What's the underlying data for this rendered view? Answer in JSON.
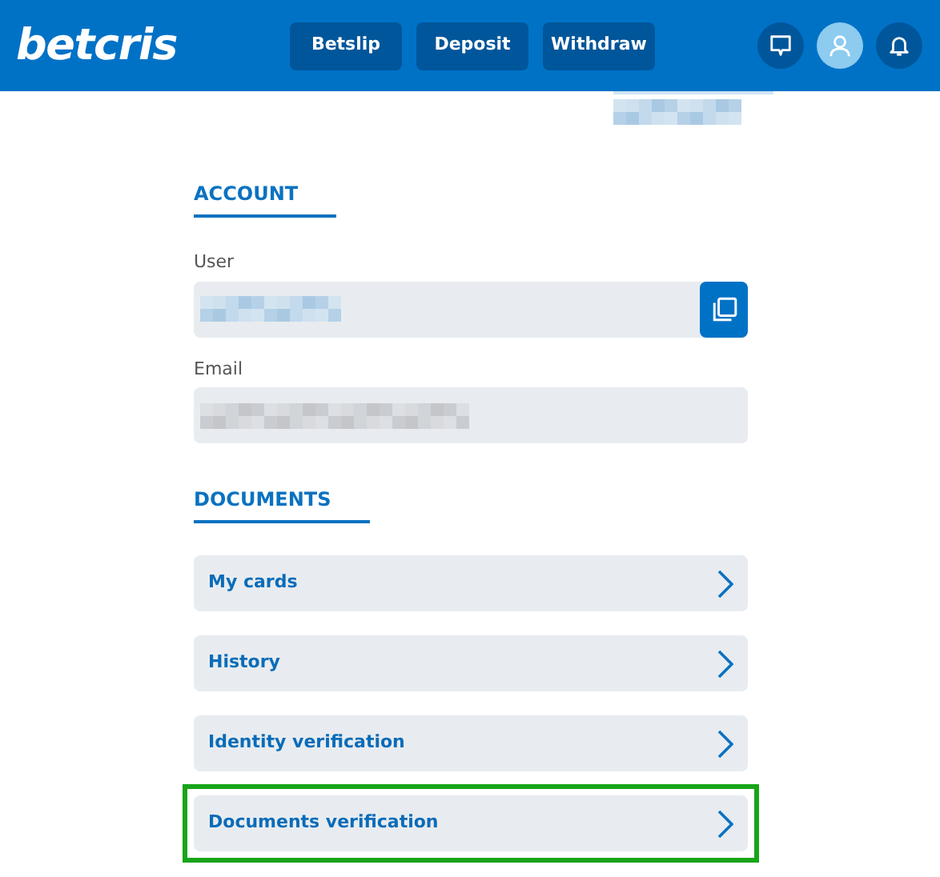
{
  "header": {
    "logo": "betcris",
    "buttons": [
      "Betslip",
      "Deposit",
      "Withdraw"
    ]
  },
  "account": {
    "title": "ACCOUNT",
    "fields": [
      {
        "label": "User",
        "copyable": true
      },
      {
        "label": "Email",
        "copyable": false
      }
    ]
  },
  "documents": {
    "title": "DOCUMENTS",
    "items": [
      {
        "label": "My cards",
        "highlighted": false
      },
      {
        "label": "History",
        "highlighted": false
      },
      {
        "label": "Identity verification",
        "highlighted": false
      },
      {
        "label": "Documents verification",
        "highlighted": true
      }
    ]
  }
}
